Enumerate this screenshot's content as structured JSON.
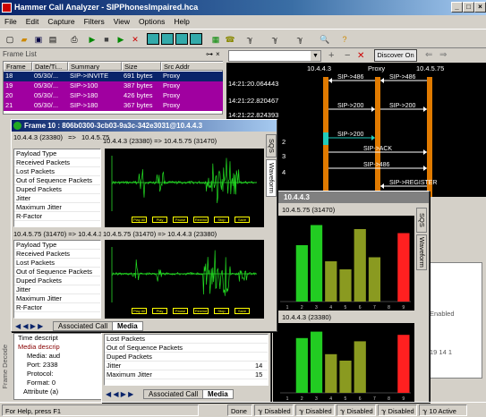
{
  "app": {
    "title": "Hammer Call Analyzer - SIPPhonesImpaired.hca"
  },
  "menu": [
    "File",
    "Edit",
    "Capture",
    "Filters",
    "View",
    "Options",
    "Help"
  ],
  "toolbar": {
    "discover_label": "Discover On"
  },
  "frame_list": {
    "title": "Frame List",
    "columns": [
      "Frame",
      "Date/Ti...",
      "Summary",
      "Size",
      "Src Addr"
    ],
    "rows": [
      {
        "frame": "18",
        "date": "05/30/...",
        "summary": "SIP->INVITE",
        "size": "691 bytes",
        "src": "Proxy",
        "color": "#0a246a"
      },
      {
        "frame": "19",
        "date": "05/30/...",
        "summary": "SIP->100",
        "size": "387 bytes",
        "src": "Proxy",
        "color": "#a000a0"
      },
      {
        "frame": "20",
        "date": "05/30/...",
        "summary": "SIP->180",
        "size": "426 bytes",
        "src": "Proxy",
        "color": "#a000a0"
      },
      {
        "frame": "21",
        "date": "05/30/...",
        "summary": "SIP->180",
        "size": "367 bytes",
        "src": "Proxy",
        "color": "#a000a0"
      }
    ]
  },
  "ladder": {
    "headers": [
      "10.4.4.3",
      "Proxy",
      "10.4.5.75"
    ],
    "times": [
      "14:21:20.064443",
      "14:21:22.820467",
      "14:21:22.824393"
    ],
    "messages": [
      "SIP->486",
      "SIP->200",
      "SIP->200",
      "SIP->200",
      "SIP->200",
      "SIP->ACK",
      "SIP->486",
      "SIP->REGISTER"
    ],
    "row_numbers": [
      "2",
      "3",
      "4"
    ]
  },
  "frame_window": {
    "title": "Frame 10 : 806b0300-3cb03-9a3c-342e3031@10.4.4.3",
    "endpoint_a": "10.4.4.3 (23380)",
    "arrow": "=>",
    "endpoint_b": "10.4.5.75",
    "stats_a_header": "10.4.4.3 (23380)  =>  10.4.5.75 (31470)",
    "stats_b_header": "10.4.5.75 (31470)  =>  10.4.4.3 (23380)",
    "stats": [
      "Payload Type",
      "Received Packets",
      "Lost Packets",
      "Out of Sequence Packets",
      "Duped Packets",
      "Jitter",
      "Maximum Jitter",
      "R-Factor"
    ],
    "wave_a_label": "10.4.4.3 (23380)  =>  10.4.5.75 (31470)",
    "wave_b_label": "10.4.5.75 (31470)  =>  10.4.4.3 (23380)",
    "wave_buttons": [
      "Play All",
      "Play",
      "Pause",
      "Rewind",
      "Stop",
      "Save"
    ],
    "tabs": [
      "Associated Call",
      "Media"
    ],
    "side_tabs": [
      "SQS",
      "Waveform"
    ]
  },
  "sqs_window": {
    "title": "10.4.4.3",
    "chart_a_label": "10.4.5.75 (31470)",
    "chart_b_label": "10.4.4.3 (23380)",
    "side_tabs": [
      "SQS",
      "Waveform"
    ],
    "tabs": [
      "Associated Call",
      "Media"
    ],
    "stats": [
      "Lost Packets",
      "Out of Sequence Packets",
      "Duped Packets",
      "Jitter",
      "Maximum Jitter"
    ],
    "stat_values": [
      "",
      "",
      "",
      "14",
      "15"
    ],
    "x_ticks": [
      "1",
      "2",
      "3",
      "4",
      "5",
      "6",
      "7",
      "8",
      "9"
    ]
  },
  "chart_data": [
    {
      "type": "bar",
      "title": "",
      "categories": [
        "1",
        "2",
        "3",
        "4",
        "5",
        "6",
        "7",
        "8",
        "9"
      ],
      "values": [
        0,
        70,
        95,
        50,
        40,
        90,
        55,
        0,
        85
      ],
      "colors": [
        "#22cc22",
        "#22cc22",
        "#22cc22",
        "#8a9a20",
        "#8a9a20",
        "#8a9a20",
        "#8a9a20",
        "#8a9a20",
        "#ff2020"
      ]
    },
    {
      "type": "bar",
      "title": "",
      "categories": [
        "1",
        "2",
        "3",
        "4",
        "5",
        "6",
        "7",
        "8",
        "9"
      ],
      "values": [
        0,
        85,
        95,
        60,
        50,
        80,
        0,
        0,
        90
      ],
      "colors": [
        "#22cc22",
        "#22cc22",
        "#22cc22",
        "#8a9a20",
        "#8a9a20",
        "#8a9a20",
        "#8a9a20",
        "#8a9a20",
        "#ff2020"
      ]
    }
  ],
  "frame_decode": {
    "title": "Frame Decode",
    "lines": [
      "Time descript",
      "Media descrip",
      "Media: aud",
      "Port: 2338",
      "Protocol:",
      "Format: 0",
      "Attribute (a)"
    ]
  },
  "right_lower": {
    "lines": [
      "Enabled",
      "19 14 1",
      "S"
    ]
  },
  "status": {
    "left": "For Help, press F1",
    "done": "Done",
    "disabled": "Disabled",
    "active": "10 Active"
  }
}
